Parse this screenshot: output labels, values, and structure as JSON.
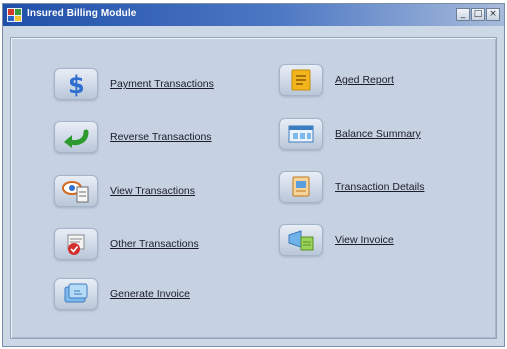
{
  "window": {
    "title": "Insured Billing Module",
    "caption_buttons": {
      "minimize": "_",
      "maximize": "□",
      "close": "×"
    }
  },
  "menu": {
    "left": [
      {
        "label": "Payment Transactions",
        "icon": "dollar-icon"
      },
      {
        "label": "Reverse Transactions",
        "icon": "reverse-arrow-icon"
      },
      {
        "label": "View Transactions",
        "icon": "view-transactions-icon"
      },
      {
        "label": "Other Transactions",
        "icon": "other-transactions-icon"
      },
      {
        "label": "Generate Invoice",
        "icon": "generate-invoice-icon"
      }
    ],
    "right": [
      {
        "label": "Aged Report",
        "icon": "report-note-icon"
      },
      {
        "label": "Balance Summary",
        "icon": "balance-summary-icon"
      },
      {
        "label": "Transaction Details",
        "icon": "transaction-details-icon"
      },
      {
        "label": "View Invoice",
        "icon": "view-invoice-icon"
      }
    ]
  },
  "colors": {
    "titlebar_start": "#1f4fa8",
    "titlebar_end": "#a7bbdb",
    "client_background": "#c6d2e1"
  }
}
